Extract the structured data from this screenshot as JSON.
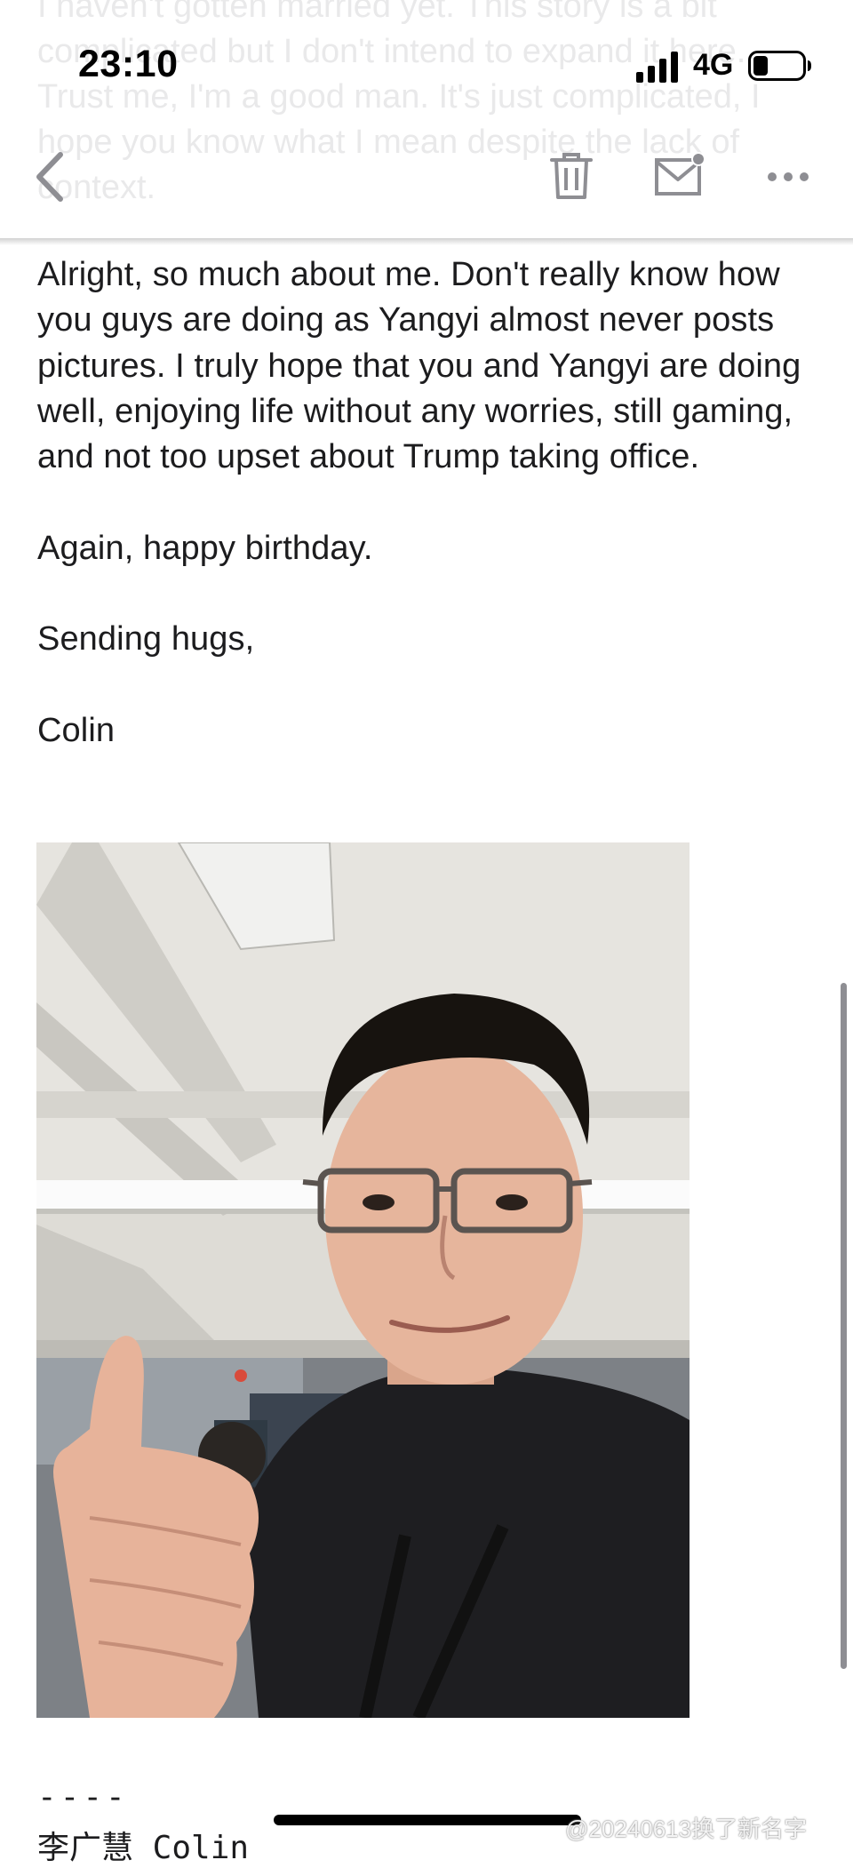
{
  "status_bar": {
    "time": "23:10",
    "network": "4G",
    "signal_icon": "cellular-signal-icon",
    "battery_icon": "battery-icon",
    "battery_level": 0.3
  },
  "nav_bar": {
    "back_icon": "chevron-left-icon",
    "trash_icon": "trash-icon",
    "mail_icon": "mail-unread-icon",
    "more_icon": "more-horizontal-icon"
  },
  "faded_text": "I haven't gotten married yet. This story is a bit complicated but I don't intend to expand it here. Trust me, I'm a good man. It's just complicated, I hope you know what I mean despite the lack of context.",
  "email_body": {
    "paragraph_1": "Alright, so much about me. Don't really know how you guys are doing as Yangyi almost never posts pictures. I truly hope that you and Yangyi are doing well, enjoying life without any worries, still gaming, and not too upset about Trump taking office.",
    "paragraph_2": "Again, happy birthday.",
    "closing": "Sending hugs,",
    "sign_off": "Colin"
  },
  "attachment": {
    "type": "selfie-photo"
  },
  "signature": {
    "dashes": "----",
    "name": "李广慧 Colin"
  },
  "watermark": "@20240613换了新名字",
  "colors": {
    "text": "#1c1c1e",
    "icon": "#8e8e93",
    "background": "#ffffff"
  }
}
